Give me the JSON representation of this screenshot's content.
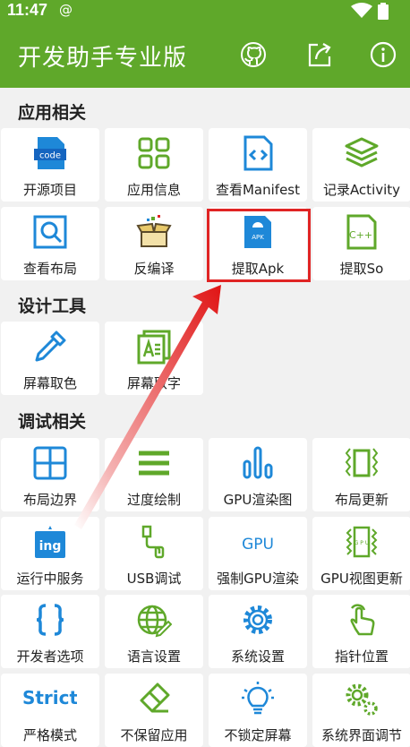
{
  "status": {
    "time": "11:47",
    "at_symbol": "@"
  },
  "appbar": {
    "title": "开发助手专业版",
    "actions": [
      "github-icon",
      "share-icon",
      "info-icon"
    ]
  },
  "colors": {
    "accent": "#5fa82a",
    "icon_blue": "#1e88d8",
    "icon_green": "#5fa82a",
    "highlight": "#e02424"
  },
  "sections": [
    {
      "title": "应用相关",
      "items": [
        {
          "label": "开源项目",
          "icon": "code-icon"
        },
        {
          "label": "应用信息",
          "icon": "grid-icon"
        },
        {
          "label": "查看Manifest",
          "icon": "manifest-icon"
        },
        {
          "label": "记录Activity",
          "icon": "layers-icon"
        },
        {
          "label": "查看布局",
          "icon": "layout-search-icon"
        },
        {
          "label": "反编译",
          "icon": "box-icon"
        },
        {
          "label": "提取Apk",
          "icon": "apk-icon"
        },
        {
          "label": "提取So",
          "icon": "so-file-icon"
        }
      ]
    },
    {
      "title": "设计工具",
      "items": [
        {
          "label": "屏幕取色",
          "icon": "dropper-icon"
        },
        {
          "label": "屏幕取字",
          "icon": "text-extract-icon"
        }
      ]
    },
    {
      "title": "调试相关",
      "items": [
        {
          "label": "布局边界",
          "icon": "layout-bounds-icon"
        },
        {
          "label": "过度绘制",
          "icon": "menu-lines-icon"
        },
        {
          "label": "GPU渲染图",
          "icon": "bar-chart-icon"
        },
        {
          "label": "布局更新",
          "icon": "layout-update-icon"
        },
        {
          "label": "运行中服务",
          "icon": "running-service-icon"
        },
        {
          "label": "USB调试",
          "icon": "usb-icon"
        },
        {
          "label": "强制GPU渲染",
          "icon": "gpu-text-icon"
        },
        {
          "label": "GPU视图更新",
          "icon": "gpu-chip-icon"
        },
        {
          "label": "开发者选项",
          "icon": "braces-icon"
        },
        {
          "label": "语言设置",
          "icon": "globe-icon"
        },
        {
          "label": "系统设置",
          "icon": "gear-icon"
        },
        {
          "label": "指针位置",
          "icon": "pointer-icon"
        },
        {
          "label": "严格模式",
          "icon": "strict-icon"
        },
        {
          "label": "不保留应用",
          "icon": "eraser-icon"
        },
        {
          "label": "不锁定屏幕",
          "icon": "bulb-icon"
        },
        {
          "label": "系统界面调节",
          "icon": "gears-icon"
        }
      ]
    }
  ],
  "icon_text": {
    "code": "code",
    "apk": "APK",
    "so": "C++",
    "ing": "ing",
    "gpu": "GPU",
    "gpu_chip": "G P U",
    "strict": "Strict"
  }
}
